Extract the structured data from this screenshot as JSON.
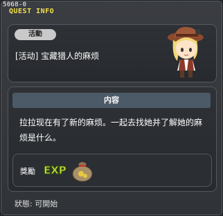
{
  "window": {
    "quest_id": "5068-0",
    "title": "QUEST INFO"
  },
  "quest": {
    "category_badge": "活動",
    "name": "[活动] 宝藏猎人的麻烦"
  },
  "content": {
    "header": "内容",
    "description": "拉拉现在有了新的麻烦。一起去找她并了解她的麻烦是什么。"
  },
  "reward": {
    "label": "獎勵",
    "exp_text": "EXP",
    "items": [
      "exp-icon",
      "money-bag-icon"
    ]
  },
  "status": {
    "text": "狀態: 可開始"
  },
  "colors": {
    "title": "#f2e04b",
    "header_bg": "#4b5a66",
    "badge_bg": "#c9c9c9"
  }
}
